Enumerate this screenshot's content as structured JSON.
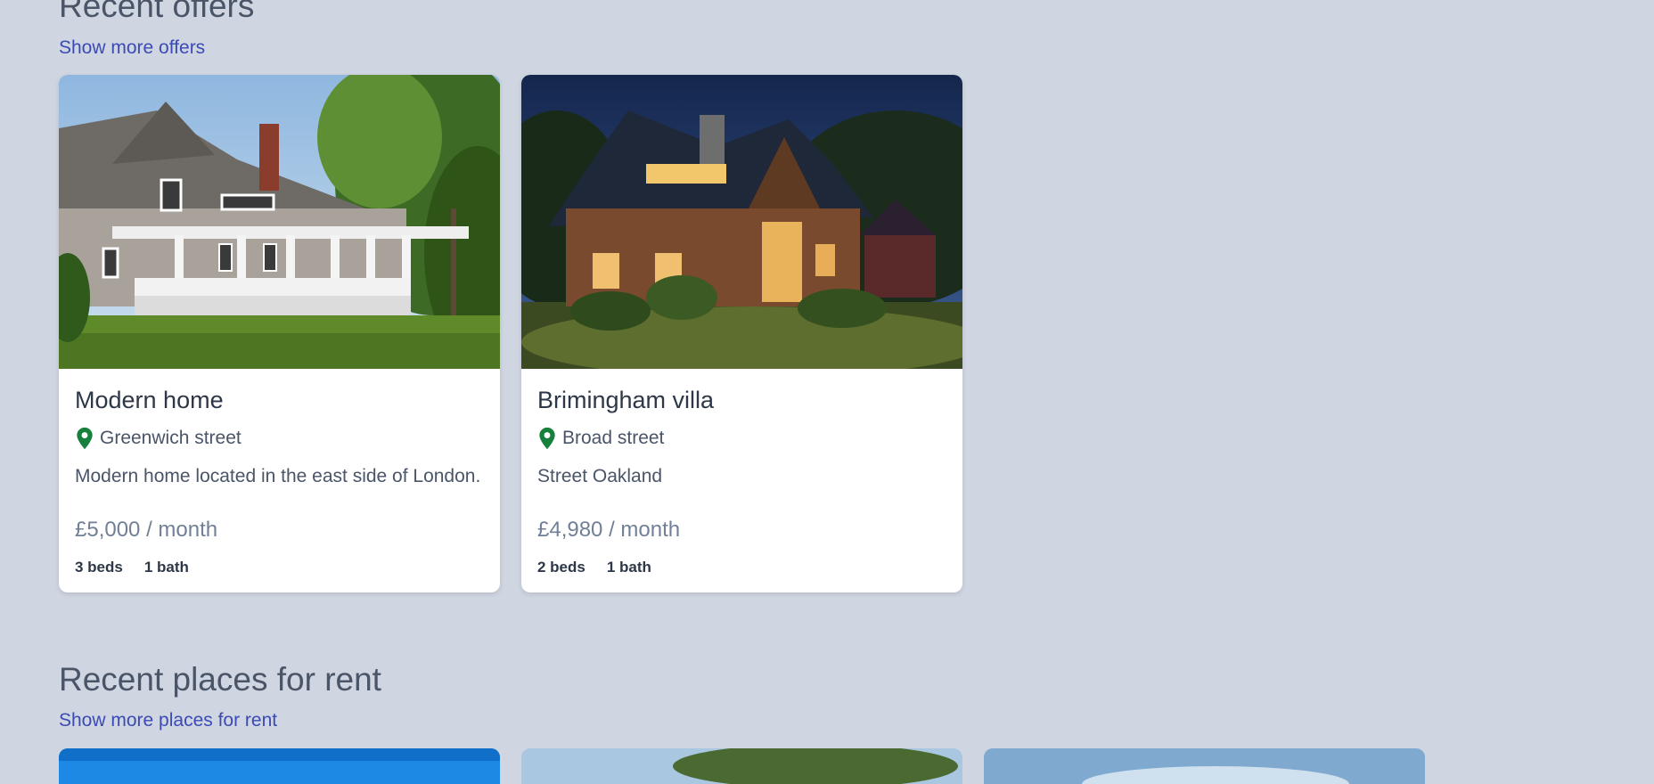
{
  "offers": {
    "title": "Recent offers",
    "link": "Show more offers",
    "cards": [
      {
        "title": "Modern home",
        "location": "Greenwich street",
        "description": "Modern home located in the east side of London.",
        "price": "£5,000 / month",
        "beds": "3 beds",
        "baths": "1 bath"
      },
      {
        "title": "Brimingham villa",
        "location": "Broad street",
        "description": "Street Oakland",
        "price": "£4,980 / month",
        "beds": "2 beds",
        "baths": "1 bath"
      }
    ]
  },
  "rent": {
    "title": "Recent places for rent",
    "link": "Show more places for rent"
  },
  "colors": {
    "background": "#cfd6e2",
    "link": "#3b4ab5",
    "pin": "#16803c"
  }
}
